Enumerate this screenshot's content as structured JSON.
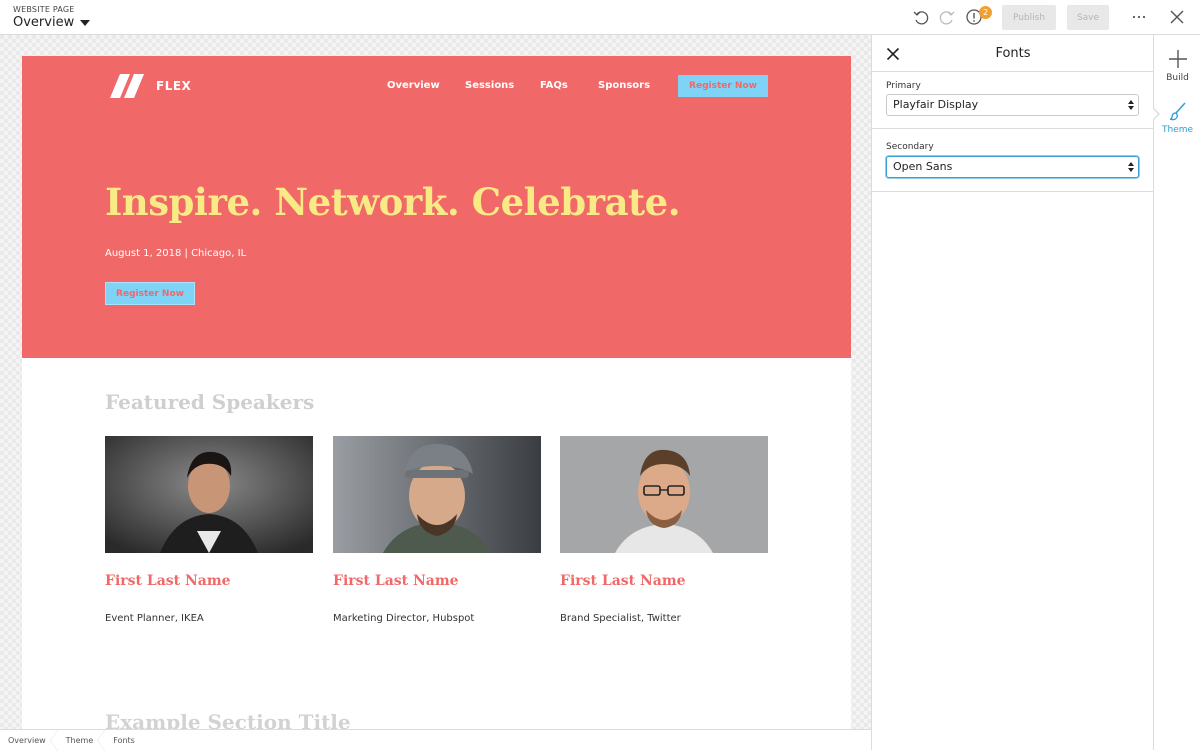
{
  "topbar": {
    "page_type_label": "WEBSITE PAGE",
    "page_select_value": "Overview",
    "notification_count": "2",
    "publish_label": "Publish",
    "save_label": "Save"
  },
  "site": {
    "brand": "FLEX",
    "nav": [
      "Overview",
      "Sessions",
      "FAQs",
      "Sponsors"
    ],
    "register_top_label": "Register Now",
    "headline": "Inspire. Network. Celebrate.",
    "dateline": "August 1, 2018 | Chicago, IL",
    "register_hero_label": "Register Now",
    "featured_title": "Featured Speakers",
    "speakers": [
      {
        "name": "First Last Name",
        "role": "Event Planner, IKEA"
      },
      {
        "name": "First Last Name",
        "role": "Marketing Director, Hubspot"
      },
      {
        "name": "First Last Name",
        "role": "Brand Specialist, Twitter"
      }
    ],
    "example_section_title": "Example Section Title"
  },
  "breadcrumb": [
    "Overview",
    "Theme",
    "Fonts"
  ],
  "panel": {
    "title": "Fonts",
    "primary_label": "Primary",
    "primary_value": "Playfair Display",
    "secondary_label": "Secondary",
    "secondary_value": "Open Sans"
  },
  "rail": {
    "build_label": "Build",
    "theme_label": "Theme"
  },
  "colors": {
    "hero_bg": "#f06868",
    "headline": "#f8ea84",
    "accent_button": "#7fd3f7",
    "rail_active": "#2a9fd6",
    "badge": "#f0a030"
  }
}
